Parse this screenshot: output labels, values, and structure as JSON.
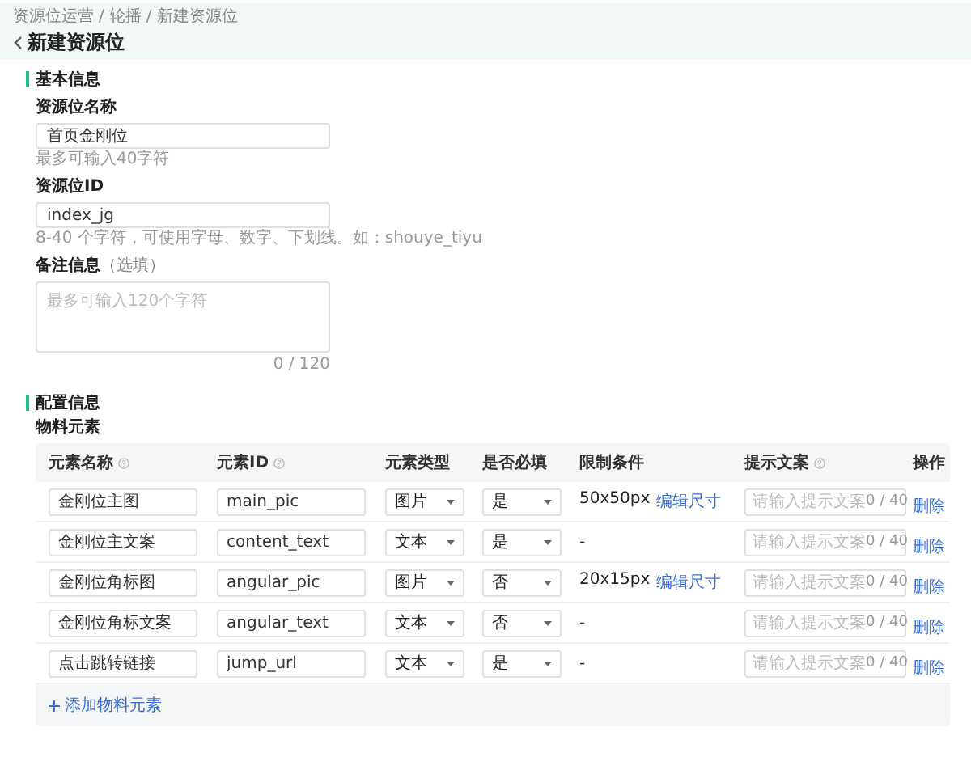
{
  "header": {
    "separator": "/",
    "breadcrumb": [
      {
        "label": "资源位运营"
      },
      {
        "label": "轮播"
      },
      {
        "label": "新建资源位"
      }
    ],
    "title": "新建资源位"
  },
  "basic_section": {
    "title": "基本信息",
    "fields": [
      {
        "kind": "input",
        "label": "资源位名称",
        "value": "首页金刚位",
        "help": "最多可输入40字符"
      },
      {
        "kind": "input",
        "label": "资源位ID",
        "value": "index_jg",
        "help": "8-40 个字符，可使用字母、数字、下划线。如：shouye_tiyu"
      },
      {
        "kind": "textarea",
        "label": "备注信息",
        "optional": "（选填）",
        "placeholder": "最多可输入120个字符",
        "counter": "0 / 120"
      }
    ]
  },
  "config_section": {
    "title": "配置信息",
    "subtitle": "物料元素",
    "table": {
      "columns": [
        {
          "label": "元素名称",
          "help": true
        },
        {
          "label": "元素ID",
          "help": true
        },
        {
          "label": "元素类型",
          "help": false
        },
        {
          "label": "是否必填",
          "help": false
        },
        {
          "label": "限制条件",
          "help": false
        },
        {
          "label": "提示文案",
          "help": true
        },
        {
          "label": "操作",
          "help": false
        }
      ],
      "rows": [
        {
          "name": "金刚位主图",
          "id": "main_pic",
          "type": "图片",
          "required": "是",
          "limit": "50x50px",
          "limit_link": "编辑尺寸",
          "hint_placeholder": "请输入提示文案",
          "counter": "0 / 40",
          "action": "删除"
        },
        {
          "name": "金刚位主文案",
          "id": "content_text",
          "type": "文本",
          "required": "是",
          "limit": "-",
          "hint_placeholder": "请输入提示文案",
          "counter": "0 / 40",
          "action": "删除"
        },
        {
          "name": "金刚位角标图",
          "id": "angular_pic",
          "type": "图片",
          "required": "否",
          "limit": "20x15px",
          "limit_link": "编辑尺寸",
          "hint_placeholder": "请输入提示文案",
          "counter": "0 / 40",
          "action": "删除"
        },
        {
          "name": "金刚位角标文案",
          "id": "angular_text",
          "type": "文本",
          "required": "否",
          "limit": "-",
          "hint_placeholder": "请输入提示文案",
          "counter": "0 / 40",
          "action": "删除"
        },
        {
          "name": "点击跳转链接",
          "id": "jump_url",
          "type": "文本",
          "required": "是",
          "limit": "-",
          "hint_placeholder": "请输入提示文案",
          "counter": "0 / 40",
          "action": "删除"
        }
      ],
      "add_link": "添加物料元素"
    }
  }
}
